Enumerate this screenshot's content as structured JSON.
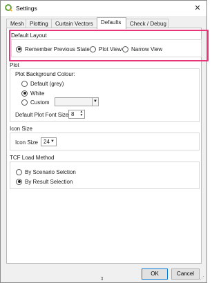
{
  "window": {
    "title": "Settings"
  },
  "tabs": [
    {
      "label": "Mesh"
    },
    {
      "label": "Plotting"
    },
    {
      "label": "Curtain Vectors"
    },
    {
      "label": "Defaults"
    },
    {
      "label": "Check / Debug"
    }
  ],
  "default_layout": {
    "title": "Default Layout",
    "options": [
      {
        "label": "Remember Previous State",
        "checked": true
      },
      {
        "label": "Plot View",
        "checked": false
      },
      {
        "label": "Narrow View",
        "checked": false
      }
    ]
  },
  "plot": {
    "title": "Plot",
    "background_colour_label": "Plot Background Colour:",
    "options": [
      {
        "label": "Default (grey)",
        "checked": false
      },
      {
        "label": "White",
        "checked": true
      },
      {
        "label": "Custom",
        "checked": false
      }
    ],
    "font_size_label": "Default Plot Font Size",
    "font_size_value": "8"
  },
  "icon_size": {
    "title": "Icon Size",
    "label": "Icon Size",
    "value": "24"
  },
  "tcf_load_method": {
    "title": "TCF Load Method",
    "options": [
      {
        "label": "By Scenario Selction",
        "checked": false
      },
      {
        "label": "By Result Selection",
        "checked": true
      }
    ]
  },
  "buttons": {
    "ok": "OK",
    "cancel": "Cancel"
  },
  "colors": {
    "highlight": "#e8357a",
    "ok_border": "#0078d7"
  }
}
